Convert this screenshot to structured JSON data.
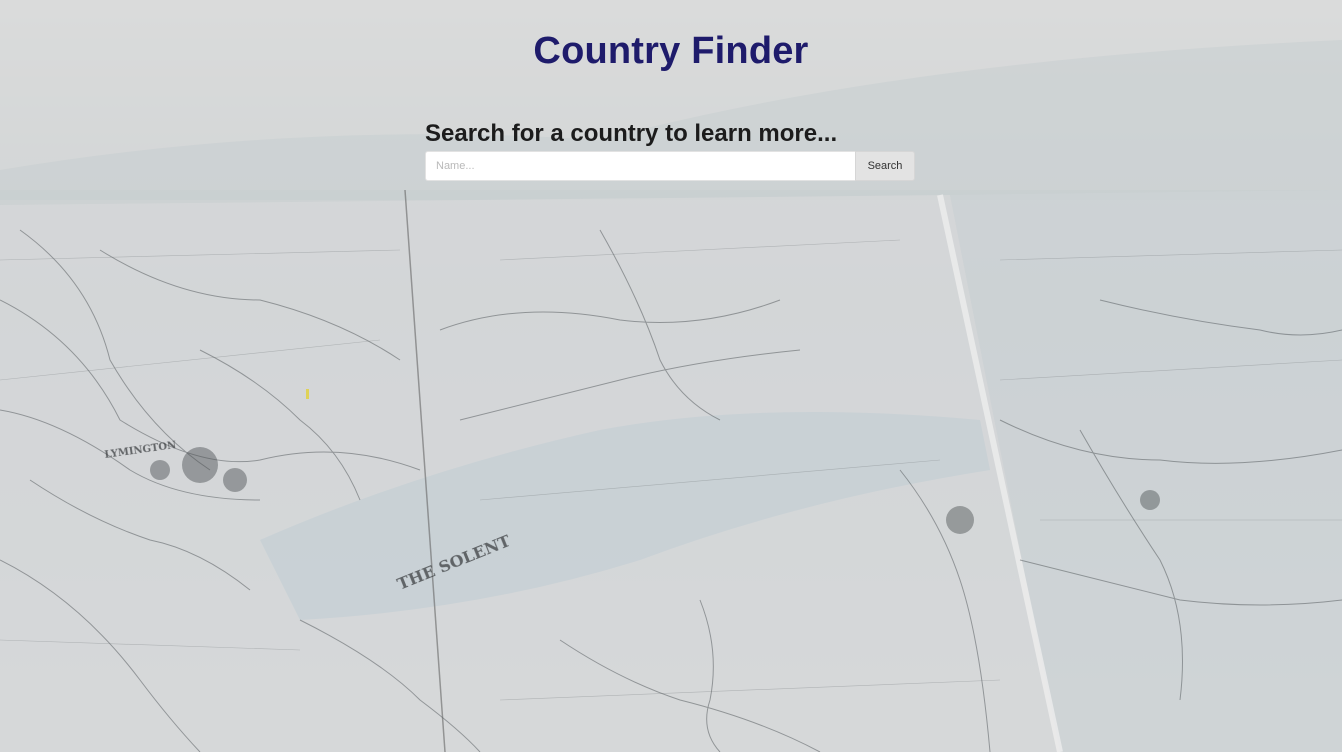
{
  "page": {
    "title": "Country Finder",
    "background_image": "blurred-vintage-map",
    "map_labels": [
      "THE SOLENT",
      "LYMINGTON"
    ]
  },
  "search": {
    "prompt": "Search for a country to learn more...",
    "placeholder": "Name...",
    "value": "",
    "button_label": "Search"
  },
  "colors": {
    "title": "#1e1b6b",
    "prompt": "#1c1c1c",
    "button_bg": "#e3e3e3",
    "input_bg": "#ffffff"
  }
}
